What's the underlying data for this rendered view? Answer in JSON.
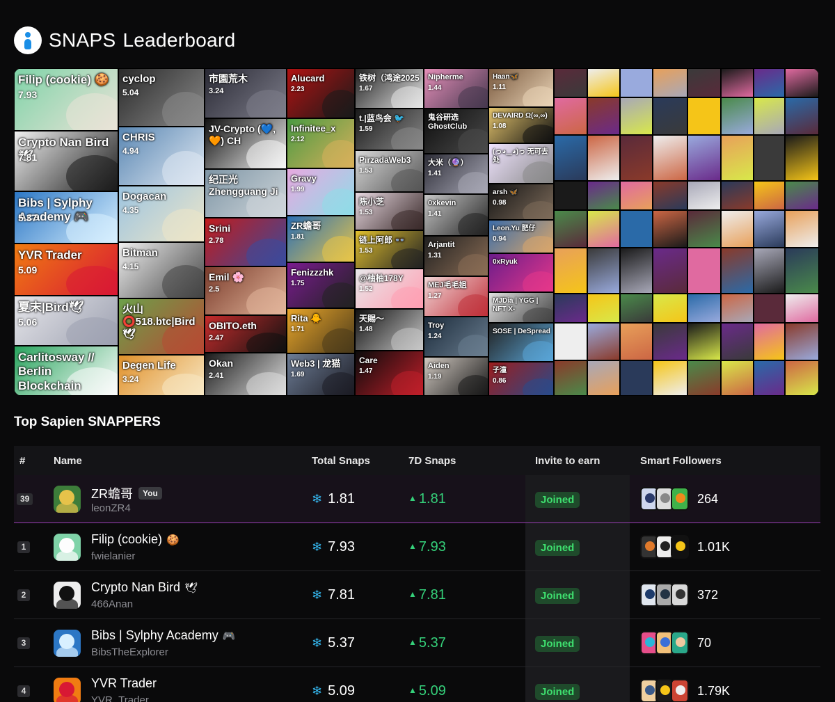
{
  "header": {
    "logo_icon": "sapien-person-icon",
    "title_a": "SNAPS",
    "title_b": "Leaderboard"
  },
  "mosaic": [
    {
      "name": "Filip (cookie) 🍪",
      "value": "7.93",
      "c1": "#7fd3a8",
      "c2": "#e9e3d7",
      "fs": 17
    },
    {
      "name": "Crypto Nan Bird 🕊",
      "value": "7.81",
      "c1": "#f0f0f0",
      "c2": "#1b1b1b",
      "fs": 17
    },
    {
      "name": "Bibs | Sylphy Academy 🎮",
      "value": "5.37",
      "c1": "#2c77c5",
      "c2": "#d8f0ff",
      "fs": 17
    },
    {
      "name": "YVR Trader",
      "value": "5.09",
      "c1": "#f07c12",
      "c2": "#d81834",
      "fs": 17
    },
    {
      "name": "夏末|Bird🕊",
      "value": "5.06",
      "c1": "#e6e6ea",
      "c2": "#9ca0b0",
      "fs": 17
    },
    {
      "name": "Carlitosway // Berlin Blockchain",
      "value": "",
      "c1": "#29a55e",
      "c2": "#fcfcfc",
      "fs": 17
    },
    {
      "name": "cyclop",
      "value": "5.04",
      "c1": "#2a2a2a",
      "c2": "#8a8a8a",
      "fs": 15
    },
    {
      "name": "CHRIS",
      "value": "4.94",
      "c1": "#5a87b3",
      "c2": "#dfe8f2",
      "fs": 15
    },
    {
      "name": "Dogacan",
      "value": "4.35",
      "c1": "#9dc4e0",
      "c2": "#ede6c9",
      "fs": 15
    },
    {
      "name": "Bitman",
      "value": "4.15",
      "c1": "#efefef",
      "c2": "#444",
      "fs": 15
    },
    {
      "name": "火山 ⭕518.btc|Bird 🕊",
      "value": "",
      "c1": "#6ca04a",
      "c2": "#b64a33",
      "fs": 15
    },
    {
      "name": "Degen Life",
      "value": "3.24",
      "c1": "#e0902a",
      "c2": "#f7e7c3",
      "fs": 15
    },
    {
      "name": "市園荒木",
      "value": "3.24",
      "c1": "#2a2a35",
      "c2": "#7d7d8a",
      "fs": 14
    },
    {
      "name": "JV-Crypto (💙,🧡) CH",
      "value": "",
      "c1": "#111",
      "c2": "#f5f5f5",
      "fs": 14
    },
    {
      "name": "纪正光 Zhengguang Ji",
      "value": "",
      "c1": "#7f96a6",
      "c2": "#cfd6da",
      "fs": 14
    },
    {
      "name": "Srini",
      "value": "2.78",
      "c1": "#c21b1b",
      "c2": "#3a4a9c",
      "fs": 14
    },
    {
      "name": "Emil 🌸",
      "value": "2.5",
      "c1": "#7b3c2c",
      "c2": "#e2b59a",
      "fs": 14
    },
    {
      "name": "OBITO.eth",
      "value": "2.47",
      "c1": "#c62c2c",
      "c2": "#111",
      "fs": 14
    },
    {
      "name": "Okan",
      "value": "2.41",
      "c1": "#1a1a1a",
      "c2": "#ddd",
      "fs": 14
    },
    {
      "name": "Alucard",
      "value": "2.23",
      "c1": "#b11212",
      "c2": "#1a1a1a",
      "fs": 13
    },
    {
      "name": "Infinitee_x",
      "value": "2.12",
      "c1": "#4a9a42",
      "c2": "#d7b05b",
      "fs": 13
    },
    {
      "name": "Gravy",
      "value": "1.99",
      "c1": "#e7a9e0",
      "c2": "#8fdce8",
      "fs": 13
    },
    {
      "name": "ZR蟾哥",
      "value": "1.81",
      "c1": "#2b6fb5",
      "c2": "#e7c548",
      "fs": 13
    },
    {
      "name": "Fenizzzhk",
      "value": "1.75",
      "c1": "#7a1b8f",
      "c2": "#222",
      "fs": 13
    },
    {
      "name": "Rita 🐥",
      "value": "1.71",
      "c1": "#e8a52a",
      "c2": "#4a3a1a",
      "fs": 13
    },
    {
      "name": "Web3 | 龙猫",
      "value": "1.69",
      "c1": "#6d7d96",
      "c2": "#1c1c24",
      "fs": 13
    },
    {
      "name": "铁树（鸿途2025",
      "value": "1.67",
      "c1": "#222",
      "c2": "#e5e5e5",
      "fs": 12
    },
    {
      "name": "t.|蓝鸟会 🐦",
      "value": "1.59",
      "c1": "#1a1a1a",
      "c2": "#888",
      "fs": 12
    },
    {
      "name": "PirzadaWeb3",
      "value": "1.53",
      "c1": "#d8d8d8",
      "c2": "#555",
      "fs": 12
    },
    {
      "name": "陈小芝",
      "value": "1.53",
      "c1": "#e7d8e0",
      "c2": "#3a2a2a",
      "fs": 12
    },
    {
      "name": "链上阿郎 👓",
      "value": "1.53",
      "c1": "#e1c02e",
      "c2": "#222",
      "fs": 12
    },
    {
      "name": "@柚柚178Y",
      "value": "1.52",
      "c1": "#e8e8ea",
      "c2": "#ff9fb2",
      "fs": 12
    },
    {
      "name": "天賜～",
      "value": "1.48",
      "c1": "#111",
      "c2": "#c7c7c7",
      "fs": 12
    },
    {
      "name": "Care",
      "value": "1.47",
      "c1": "#0b0b0b",
      "c2": "#c01f2a",
      "fs": 12
    },
    {
      "name": "Nipherme",
      "value": "1.44",
      "c1": "#e58fb9",
      "c2": "#47384f",
      "fs": 11
    },
    {
      "name": "鬼谷研选 GhostClub",
      "value": "",
      "c1": "#0d0d0d",
      "c2": "#4b4b4b",
      "fs": 11
    },
    {
      "name": "大米（🔮）",
      "value": "1.41",
      "c1": "#2e2e38",
      "c2": "#a7a7b5",
      "fs": 11
    },
    {
      "name": "0xkevin",
      "value": "1.41",
      "c1": "#c7c7c7",
      "c2": "#232323",
      "fs": 11
    },
    {
      "name": "Arjantit",
      "value": "1.31",
      "c1": "#202020",
      "c2": "#8b6d55",
      "fs": 11
    },
    {
      "name": "MEJ毛毛姐",
      "value": "1.27",
      "c1": "#f1d6d6",
      "c2": "#c0313b",
      "fs": 11
    },
    {
      "name": "Troy",
      "value": "1.24",
      "c1": "#1c2c3c",
      "c2": "#6a7d8f",
      "fs": 11
    },
    {
      "name": "Aiden",
      "value": "1.19",
      "c1": "#d0c8c0",
      "c2": "#1a1a1a",
      "fs": 11
    },
    {
      "name": "Haan🦋",
      "value": "1.11",
      "c1": "#7a5a3f",
      "c2": "#e9d3b6",
      "fs": 10
    },
    {
      "name": "DEVAIRD Ω(∞,∞)",
      "value": "1.08",
      "c1": "#e4c46d",
      "c2": "#111",
      "fs": 10
    },
    {
      "name": "(っ◕‿◕)っ 无可去处",
      "value": "",
      "c1": "#f0e4ff",
      "c2": "#888",
      "fs": 10
    },
    {
      "name": "arsh 🦋",
      "value": "0.98",
      "c1": "#151515",
      "c2": "#7d6b5a",
      "fs": 10
    },
    {
      "name": "Leon.Yu 肥仔",
      "value": "0.94",
      "c1": "#3c6ca8",
      "c2": "#d9a66b",
      "fs": 10
    },
    {
      "name": "0xRyuk",
      "value": "",
      "c1": "#6b1d8a",
      "c2": "#e5378a",
      "fs": 10
    },
    {
      "name": "MJDia | YGG | NFT X-",
      "value": "",
      "c1": "#e0e0e0",
      "c2": "#444",
      "fs": 10
    },
    {
      "name": "SOSE | DeSpread",
      "value": "",
      "c1": "#222",
      "c2": "#5aa6d8",
      "fs": 10
    },
    {
      "name": "子潼",
      "value": "0.86",
      "c1": "#9b1d1d",
      "c2": "#2a4a8a",
      "fs": 10
    }
  ],
  "section_title": "Top Sapien SNAPPERS",
  "table": {
    "headers": {
      "rank": "#",
      "name": "Name",
      "total": "Total Snaps",
      "seven_day": "7D Snaps",
      "invite": "Invite to earn",
      "followers": "Smart Followers"
    },
    "snap_icon": "snowflake-snap-icon",
    "rows": [
      {
        "rank": "39",
        "name": "ZR蟾哥",
        "you": "You",
        "emoji": "",
        "handle": "leonZR4",
        "total": "1.81",
        "seven_day": "1.81",
        "invite": "Joined",
        "followers": "264",
        "me": true,
        "av": [
          "#e6c24a",
          "#3d7d3a"
        ],
        "fav": [
          [
            "#2b3b6b",
            "#cfd8ee"
          ],
          [
            "#888",
            "#ddd"
          ],
          [
            "#f08a1c",
            "#3fb24a"
          ]
        ]
      },
      {
        "rank": "1",
        "name": "Filip (cookie)",
        "you": "",
        "emoji": "🍪",
        "handle": "fwielanier",
        "total": "7.93",
        "seven_day": "7.93",
        "invite": "Joined",
        "followers": "1.01K",
        "me": false,
        "av": [
          "#fdfdfd",
          "#7fd3a8"
        ],
        "fav": [
          [
            "#e07a2b",
            "#333"
          ],
          [
            "#222",
            "#eee"
          ],
          [
            "#f5c518",
            "#111"
          ]
        ]
      },
      {
        "rank": "2",
        "name": "Crypto Nan Bird",
        "you": "",
        "emoji": "🕊",
        "handle": "466Anan",
        "total": "7.81",
        "seven_day": "7.81",
        "invite": "Joined",
        "followers": "372",
        "me": false,
        "av": [
          "#111",
          "#eee"
        ],
        "fav": [
          [
            "#1d3b6b",
            "#e0e6ee"
          ],
          [
            "#234",
            "#aaa"
          ],
          [
            "#333",
            "#d9d9d9"
          ]
        ]
      },
      {
        "rank": "3",
        "name": "Bibs | Sylphy Academy",
        "you": "",
        "emoji": "🎮",
        "handle": "BibsTheExplorer",
        "total": "5.37",
        "seven_day": "5.37",
        "invite": "Joined",
        "followers": "70",
        "me": false,
        "av": [
          "#d8f0ff",
          "#2c77c5"
        ],
        "fav": [
          [
            "#2ab6d8",
            "#e64e8a"
          ],
          [
            "#3a6fd8",
            "#f2c07a"
          ],
          [
            "#f0c8a0",
            "#2aa88a"
          ]
        ]
      },
      {
        "rank": "4",
        "name": "YVR Trader",
        "you": "",
        "emoji": "",
        "handle": "YVR_Trader",
        "total": "5.09",
        "seven_day": "5.09",
        "invite": "Joined",
        "followers": "1.79K",
        "me": false,
        "av": [
          "#d81834",
          "#f07c12"
        ],
        "fav": [
          [
            "#3a5a8a",
            "#f0d0a0"
          ],
          [
            "#f5c518",
            "#1a1a1a"
          ],
          [
            "#eee",
            "#c43"
          ]
        ]
      }
    ]
  }
}
